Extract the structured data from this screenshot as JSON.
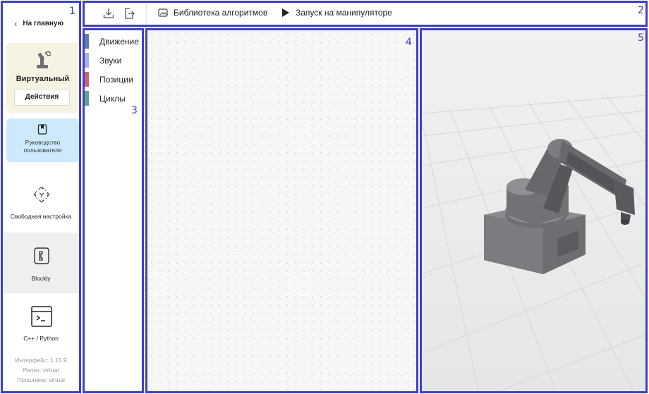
{
  "sidebar": {
    "back_label": "На главную",
    "robot": {
      "name": "Виртуальный",
      "actions_label": "Действия"
    },
    "guide_label_line1": "Руководство",
    "guide_label_line2": "пользователя",
    "nav": [
      {
        "label": "Свободная настройка",
        "icon": "move-icon"
      },
      {
        "label": "Blockly",
        "icon": "blockly-icon"
      },
      {
        "label": "C++ / Python",
        "icon": "terminal-icon"
      }
    ],
    "version": {
      "interface": "Интерфейс: 1.15.9",
      "release": "Релиз: virtual",
      "firmware": "Прошивка: virtual"
    }
  },
  "toolbar": {
    "download_icon": "download-icon",
    "export_icon": "export-icon",
    "library_label": "Библиотека алгоритмов",
    "run_label": "Запуск на манипуляторе"
  },
  "categories": [
    {
      "label": "Движение",
      "color": "#5b80a5"
    },
    {
      "label": "Звуки",
      "color": "#a5b0db"
    },
    {
      "label": "Позиции",
      "color": "#c96573"
    },
    {
      "label": "Циклы",
      "color": "#5ba58c"
    }
  ],
  "panel_numbers": {
    "p1": "1",
    "p2": "2",
    "p3": "3",
    "p4": "4",
    "p5": "5"
  },
  "colors": {
    "annotation": "#3f3fc8",
    "robot_card": "#f6f3e3",
    "guide_card": "#cde9fb"
  }
}
